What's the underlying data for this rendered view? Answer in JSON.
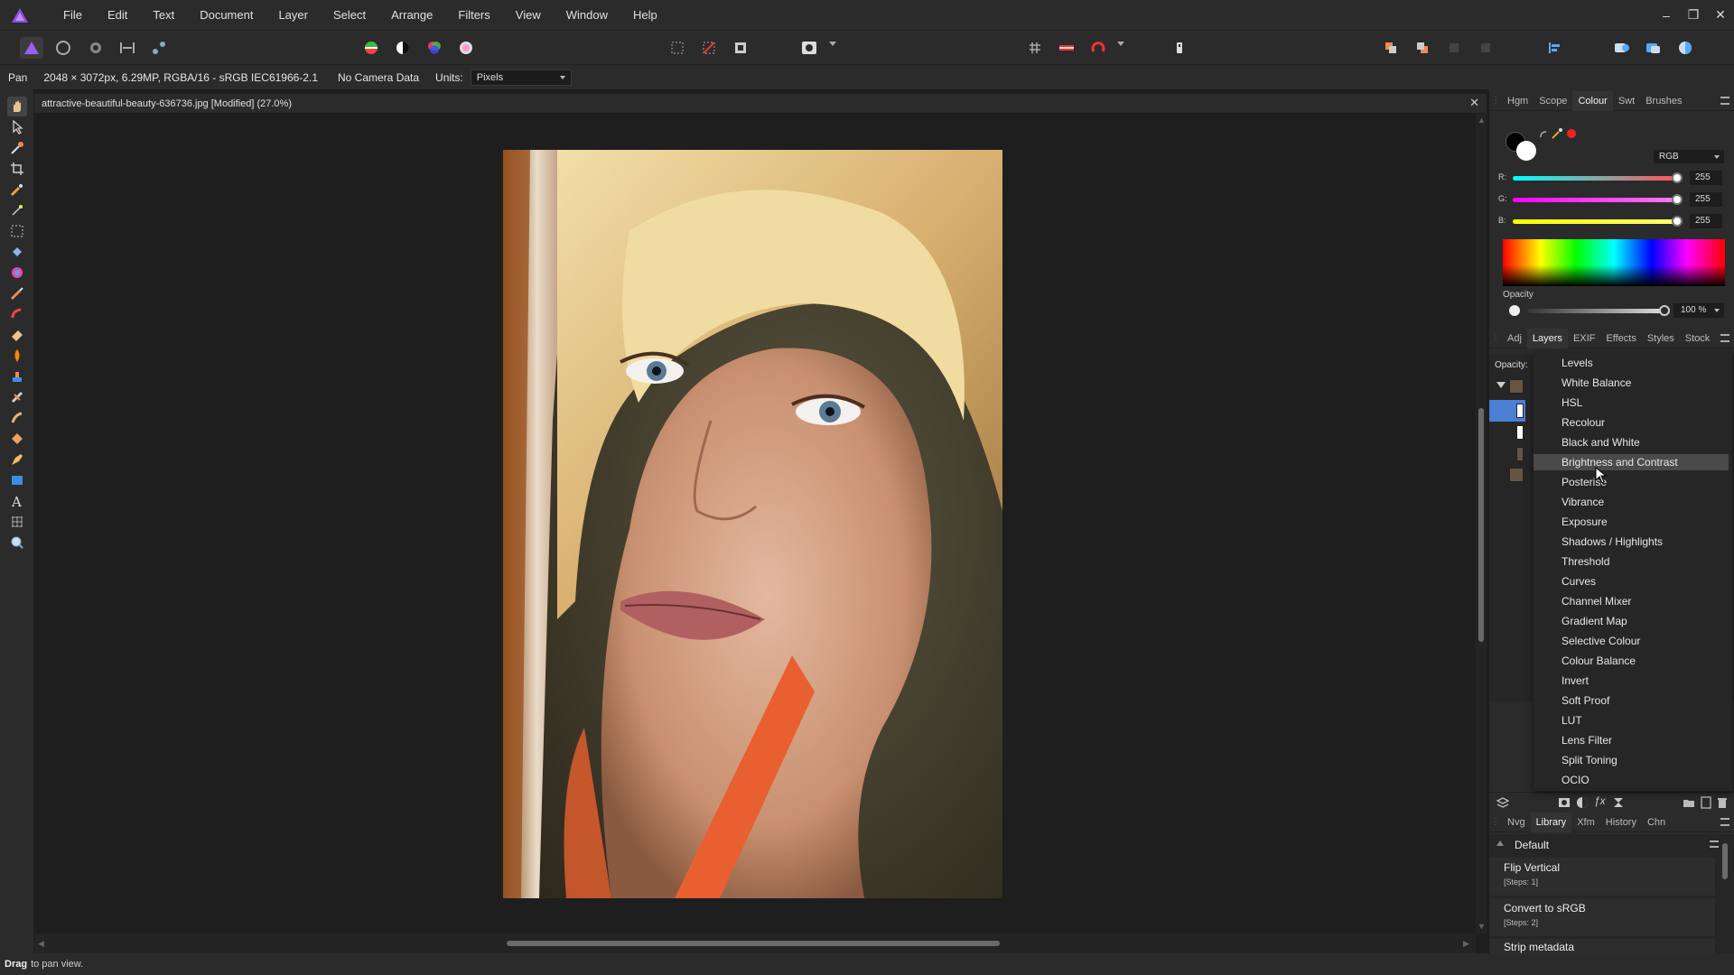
{
  "menubar": {
    "items": [
      "File",
      "Edit",
      "Text",
      "Document",
      "Layer",
      "Select",
      "Arrange",
      "Filters",
      "View",
      "Window",
      "Help"
    ]
  },
  "context": {
    "tool": "Pan",
    "info": "2048 × 3072px, 6.29MP, RGBA/16 - sRGB IEC61966-2.1",
    "camera": "No Camera Data",
    "units_label": "Units:",
    "units_value": "Pixels"
  },
  "document": {
    "title": "attractive-beautiful-beauty-636736.jpg [Modified] (27.0%)"
  },
  "status": {
    "action": "Drag",
    "text": "to pan view."
  },
  "colour_panel": {
    "tabs": [
      "Hgm",
      "Scope",
      "Colour",
      "Swt",
      "Brushes"
    ],
    "active_tab": "Colour",
    "mode": "RGB",
    "channels": [
      {
        "label": "R:",
        "value": "255",
        "color": "#ff3030"
      },
      {
        "label": "G:",
        "value": "255",
        "color": "#ff30ff"
      },
      {
        "label": "B:",
        "value": "255",
        "color": "#ffff30"
      }
    ],
    "opacity_label": "Opacity",
    "opacity_value": "100 %"
  },
  "layers_panel": {
    "tabs": [
      "Adj",
      "Layers",
      "EXIF",
      "Effects",
      "Styles",
      "Stock"
    ],
    "active_tab": "Layers",
    "opacity_label": "Opacity:"
  },
  "adjustment_menu": {
    "highlighted": "Brightness and Contrast",
    "items": [
      "Levels",
      "White Balance",
      "HSL",
      "Recolour",
      "Black and White",
      "Brightness and Contrast",
      "Posterise",
      "Vibrance",
      "Exposure",
      "Shadows / Highlights",
      "Threshold",
      "Curves",
      "Channel Mixer",
      "Gradient Map",
      "Selective Colour",
      "Colour Balance",
      "Invert",
      "Soft Proof",
      "LUT",
      "Lens Filter",
      "Split Toning",
      "OCIO"
    ]
  },
  "library_panel": {
    "tabs": [
      "Nvg",
      "Library",
      "Xfm",
      "History",
      "Chn"
    ],
    "active_tab": "Library",
    "group": "Default",
    "entries": [
      {
        "name": "Flip Vertical",
        "steps": "[Steps: 1]"
      },
      {
        "name": "Convert to sRGB",
        "steps": "[Steps: 2]"
      },
      {
        "name": "Strip metadata",
        "steps": ""
      }
    ]
  },
  "colors": {
    "accent": "#4a7fd4",
    "brand": "#7a3fd9"
  }
}
